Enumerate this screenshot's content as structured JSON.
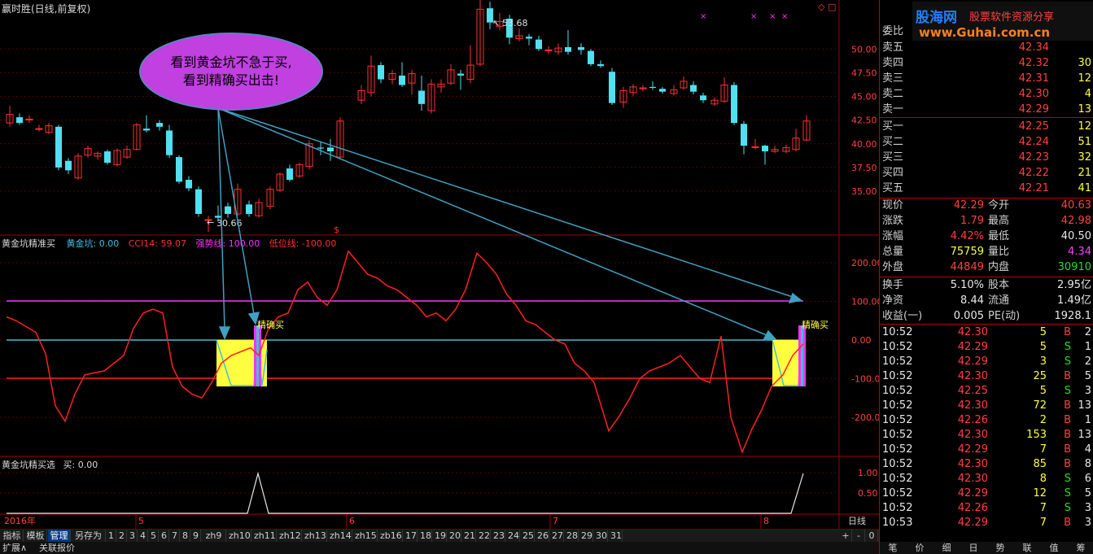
{
  "window_title": "赢时胜(日线,前复权)",
  "price_axis": [
    "50.00",
    "47.50",
    "45.00",
    "42.50",
    "40.00",
    "37.50",
    "35.00"
  ],
  "high_marker": "53.68",
  "low_marker": "30.66",
  "callout": {
    "line1": "看到黄金坑不急于买,",
    "line2": "看到精确买出击!"
  },
  "indicator1": {
    "title": "黄金坑精准买",
    "legend": [
      {
        "text": "黄金坑: 0.00",
        "color": "#40c0e0"
      },
      {
        "text": "CCI14: 59.07",
        "color": "#ff3030"
      },
      {
        "text": "强势线: 100.00",
        "color": "#ff30ff"
      },
      {
        "text": "低位线: -100.00",
        "color": "#ff3030"
      }
    ],
    "axis": [
      "200.00",
      "100.00",
      "0.00",
      "-100.00",
      "-200.00"
    ],
    "buy_label_1": "精确买",
    "buy_label_2": "精确买"
  },
  "indicator2": {
    "title": "黄金坑精买选",
    "value": "买: 0.00",
    "axis": [
      "1.00",
      "0.50"
    ]
  },
  "date_axis": {
    "year": "2016年",
    "months": [
      "5",
      "6",
      "7",
      "8"
    ],
    "period": "日线"
  },
  "toolbar": [
    "指标",
    "模板",
    "管理",
    "另存为",
    "1",
    "2",
    "3",
    "4",
    "5",
    "6",
    "7",
    "8",
    "9",
    "zh9",
    "zh10",
    "zh11",
    "zh12",
    "zh13",
    "zh14",
    "zh15",
    "zb16",
    "17",
    "18",
    "19",
    "20",
    "21",
    "22",
    "23",
    "24",
    "25",
    "26",
    "27",
    "28",
    "29",
    "30",
    "31"
  ],
  "toolbar_right": [
    "+",
    "-",
    "0"
  ],
  "status": {
    "expand": "扩展∧",
    "related": "关联报价"
  },
  "logo": {
    "brand": "股海网",
    "slogan": "股票软件资源分享",
    "url": "www.Guhai.com.cn"
  },
  "order_book": {
    "header": "委比",
    "sells": [
      {
        "label": "卖五",
        "price": "42.34",
        "vol": ""
      },
      {
        "label": "卖四",
        "price": "42.32",
        "vol": "30"
      },
      {
        "label": "卖三",
        "price": "42.31",
        "vol": "12"
      },
      {
        "label": "卖二",
        "price": "42.30",
        "vol": "4"
      },
      {
        "label": "卖一",
        "price": "42.29",
        "vol": "13"
      }
    ],
    "buys": [
      {
        "label": "买一",
        "price": "42.25",
        "vol": "12"
      },
      {
        "label": "买二",
        "price": "42.24",
        "vol": "51"
      },
      {
        "label": "买三",
        "price": "42.23",
        "vol": "32"
      },
      {
        "label": "买四",
        "price": "42.22",
        "vol": "21"
      },
      {
        "label": "买五",
        "price": "42.21",
        "vol": "41"
      }
    ]
  },
  "quote": [
    {
      "l1": "现价",
      "v1": "42.29",
      "c1": "red",
      "l2": "今开",
      "v2": "40.63",
      "c2": "red"
    },
    {
      "l1": "涨跌",
      "v1": "1.79",
      "c1": "red",
      "l2": "最高",
      "v2": "42.98",
      "c2": "red"
    },
    {
      "l1": "涨幅",
      "v1": "4.42%",
      "c1": "red",
      "l2": "最低",
      "v2": "40.50",
      "c2": "white"
    },
    {
      "l1": "总量",
      "v1": "75759",
      "c1": "yellow",
      "l2": "量比",
      "v2": "4.34",
      "c2": "magenta"
    },
    {
      "l1": "外盘",
      "v1": "44849",
      "c1": "red",
      "l2": "内盘",
      "v2": "30910",
      "c2": "green"
    }
  ],
  "fundamentals": [
    {
      "l1": "换手",
      "v1": "5.10%",
      "l2": "股本",
      "v2": "2.95亿"
    },
    {
      "l1": "净资",
      "v1": "8.44",
      "l2": "流通",
      "v2": "1.49亿"
    },
    {
      "l1": "收益(一)",
      "v1": "0.005",
      "l2": "PE(动)",
      "v2": "1928.1"
    }
  ],
  "ticks": [
    {
      "t": "10:52",
      "p": "42.30",
      "c": "red",
      "v": "5",
      "bs": "B",
      "n": "2"
    },
    {
      "t": "10:52",
      "p": "42.29",
      "c": "red",
      "v": "5",
      "bs": "S",
      "n": "1"
    },
    {
      "t": "10:52",
      "p": "42.29",
      "c": "red",
      "v": "3",
      "bs": "S",
      "n": "2"
    },
    {
      "t": "10:52",
      "p": "42.30",
      "c": "red",
      "v": "25",
      "bs": "B",
      "n": "5"
    },
    {
      "t": "10:52",
      "p": "42.25",
      "c": "red",
      "v": "5",
      "bs": "S",
      "n": "3"
    },
    {
      "t": "10:52",
      "p": "42.30",
      "c": "red",
      "v": "72",
      "bs": "B",
      "n": "13"
    },
    {
      "t": "10:52",
      "p": "42.26",
      "c": "red",
      "v": "2",
      "bs": "B",
      "n": "1"
    },
    {
      "t": "10:52",
      "p": "42.30",
      "c": "red",
      "v": "153",
      "bs": "B",
      "n": "13"
    },
    {
      "t": "10:52",
      "p": "42.29",
      "c": "red",
      "v": "7",
      "bs": "B",
      "n": "4"
    },
    {
      "t": "10:52",
      "p": "42.30",
      "c": "red",
      "v": "85",
      "bs": "B",
      "n": "8"
    },
    {
      "t": "10:52",
      "p": "42.30",
      "c": "red",
      "v": "8",
      "bs": "S",
      "n": "6"
    },
    {
      "t": "10:52",
      "p": "42.29",
      "c": "red",
      "v": "12",
      "bs": "S",
      "n": "5"
    },
    {
      "t": "10:52",
      "p": "42.26",
      "c": "red",
      "v": "7",
      "bs": "S",
      "n": "3"
    },
    {
      "t": "10:53",
      "p": "42.29",
      "c": "red",
      "v": "7",
      "bs": "B",
      "n": "3"
    }
  ],
  "right_tabs": [
    "笔",
    "价",
    "细",
    "日",
    "势",
    "联",
    "值",
    "筹"
  ]
}
